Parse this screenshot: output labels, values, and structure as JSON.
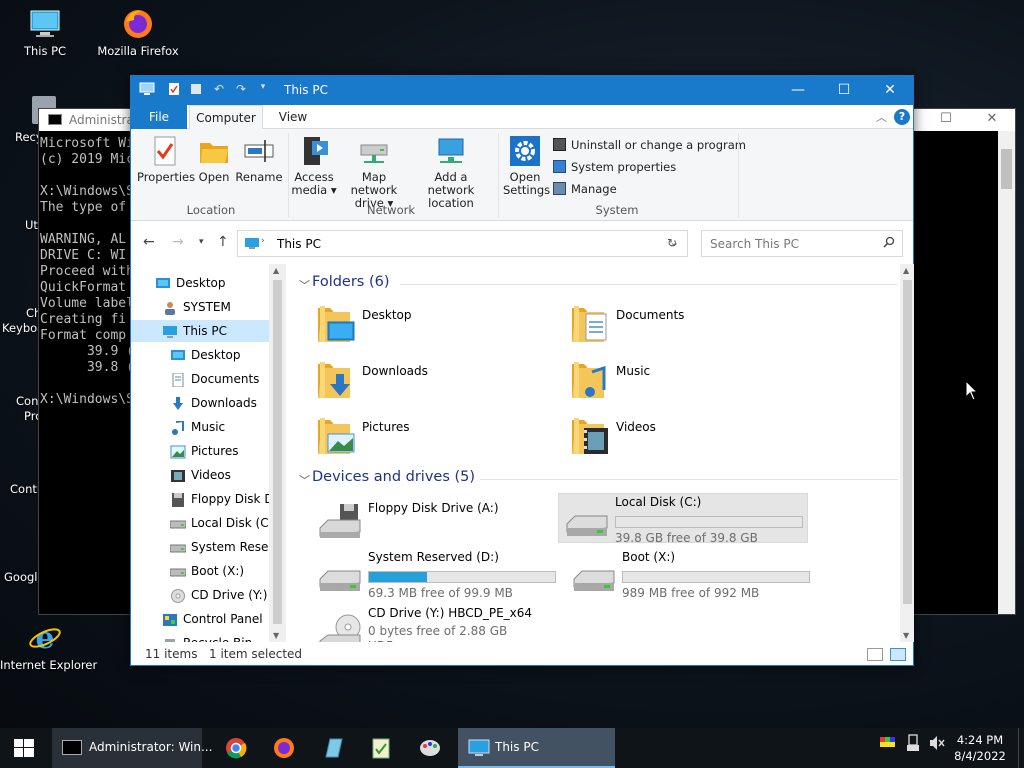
{
  "desktop": {
    "icons": [
      {
        "label": "This PC"
      },
      {
        "label": "Mozilla Firefox"
      },
      {
        "label": "Internet Explorer"
      }
    ],
    "partial_labels": [
      "Recy",
      "Ut",
      "Ch",
      "Keyboa",
      "Con",
      "Pro",
      "Contr",
      "Googl"
    ]
  },
  "console": {
    "title": "Administrator",
    "lines": [
      "Microsoft Wi",
      "(c) 2019 Mic",
      "",
      "X:\\Windows\\S",
      "The type of",
      "",
      "WARNING, AL",
      "DRIVE C: WI",
      "Proceed with",
      "QuickFormat",
      "Volume label",
      "Creating fi",
      "Format comp",
      "      39.9 (",
      "      39.8 (",
      "",
      "X:\\Windows\\S"
    ]
  },
  "explorer": {
    "title": "This PC",
    "tabs": [
      "File",
      "Computer",
      "View"
    ],
    "ribbon": {
      "location": {
        "group": "Location",
        "buttons": [
          "Properties",
          "Open",
          "Rename"
        ]
      },
      "network": {
        "group": "Network",
        "buttons": [
          [
            "Access",
            "media ▾"
          ],
          [
            "Map network",
            "drive ▾"
          ],
          [
            "Add a network",
            "location"
          ]
        ]
      },
      "system": {
        "group": "System",
        "open_settings": [
          "Open",
          "Settings"
        ],
        "items": [
          "Uninstall or change a program",
          "System properties",
          "Manage"
        ]
      }
    },
    "address": {
      "path": "This PC",
      "search_placeholder": "Search This PC"
    },
    "nav": [
      {
        "label": "Desktop",
        "level": 0,
        "icon": "desktop"
      },
      {
        "label": "SYSTEM",
        "level": 1,
        "icon": "user"
      },
      {
        "label": "This PC",
        "level": 1,
        "icon": "pc",
        "selected": true
      },
      {
        "label": "Desktop",
        "level": 2,
        "icon": "desktop"
      },
      {
        "label": "Documents",
        "level": 2,
        "icon": "documents"
      },
      {
        "label": "Downloads",
        "level": 2,
        "icon": "downloads"
      },
      {
        "label": "Music",
        "level": 2,
        "icon": "music"
      },
      {
        "label": "Pictures",
        "level": 2,
        "icon": "pictures"
      },
      {
        "label": "Videos",
        "level": 2,
        "icon": "videos"
      },
      {
        "label": "Floppy Disk Dri",
        "level": 2,
        "icon": "floppy"
      },
      {
        "label": "Local Disk (C:)",
        "level": 2,
        "icon": "drive"
      },
      {
        "label": "System Reserve",
        "level": 2,
        "icon": "drive"
      },
      {
        "label": "Boot (X:)",
        "level": 2,
        "icon": "drive"
      },
      {
        "label": "CD Drive (Y:) H",
        "level": 2,
        "icon": "cd"
      },
      {
        "label": "Control Panel",
        "level": 1,
        "icon": "control"
      },
      {
        "label": "Recycle Bin",
        "level": 1,
        "icon": "recycle"
      }
    ],
    "folders_header": "Folders (6)",
    "folders": [
      {
        "name": "Desktop",
        "overlay": "desktop"
      },
      {
        "name": "Documents",
        "overlay": "documents"
      },
      {
        "name": "Downloads",
        "overlay": "downloads"
      },
      {
        "name": "Music",
        "overlay": "music"
      },
      {
        "name": "Pictures",
        "overlay": "pictures"
      },
      {
        "name": "Videos",
        "overlay": "videos"
      }
    ],
    "drives_header": "Devices and drives (5)",
    "drives": [
      {
        "name": "Floppy Disk Drive (A:)",
        "type": "floppy"
      },
      {
        "name": "Local Disk (C:)",
        "free": "39.8 GB free of 39.8 GB",
        "used_fraction": 0.0,
        "highlight": true,
        "type": "hdd"
      },
      {
        "name": "System Reserved (D:)",
        "free": "69.3 MB free of 99.9 MB",
        "used_fraction": 0.31,
        "type": "hdd"
      },
      {
        "name": "Boot (X:)",
        "free": "989 MB free of 992 MB",
        "used_fraction": 0.0,
        "type": "hdd"
      },
      {
        "name": "CD Drive (Y:) HBCD_PE_x64",
        "free": "0 bytes free of 2.88 GB",
        "extra": "UDF",
        "type": "cd"
      }
    ],
    "status": {
      "count": "11 items",
      "selected": "1 item selected"
    }
  },
  "taskbar": {
    "apps": [
      {
        "label": "Administrator: Win..."
      },
      {
        "label": "This PC"
      }
    ],
    "clock": {
      "time": "4:24 PM",
      "date": "8/4/2022"
    }
  },
  "colors": {
    "accent": "#1979ca",
    "selection": "#cce8ff",
    "bar": "#26a0da",
    "folder": "#f4c65a"
  }
}
